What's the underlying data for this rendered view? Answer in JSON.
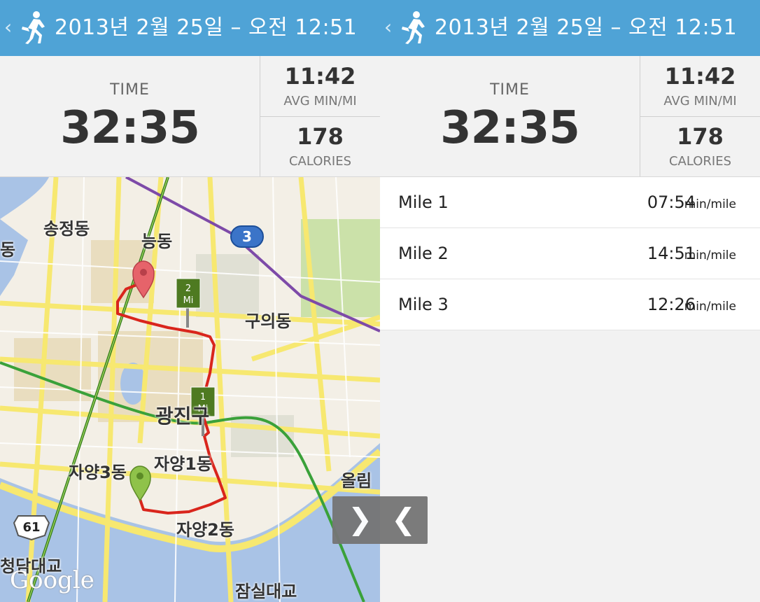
{
  "header": {
    "back_glyph": "‹",
    "runner_icon": "runner-icon",
    "title": "2013년 2월 25일 – 오전 12:51"
  },
  "stats": {
    "time_label": "TIME",
    "time_value": "32:35",
    "pace_value": "11:42",
    "pace_label": "AVG MIN/MI",
    "calories_value": "178",
    "calories_label": "CALORIES"
  },
  "map": {
    "labels": {
      "songjeong": "송정동",
      "neung": "능동",
      "dong_left": "동",
      "guui": "구의동",
      "gwangjin": "광진구",
      "jayang3": "자양3동",
      "jayang1": "자양1동",
      "jayang2": "자양2동",
      "ollim": "올림",
      "damdae": "청담대교",
      "jamsil": "잠실대교",
      "subway_line": "3",
      "highway": "61",
      "marker_2": "2",
      "marker_1": "1",
      "marker_unit": "Mi"
    },
    "attribution": "Google",
    "colors": {
      "route": "#d9251c",
      "water": "#a9c3e6",
      "road": "#f7e870",
      "park": "#cbe1a9",
      "start_pin": "#8fc24a",
      "end_pin": "#e6636a",
      "mile_marker": "#4e7a21"
    }
  },
  "splits": [
    {
      "mile": "Mile 1",
      "pace": "07:54",
      "unit": "min/mile"
    },
    {
      "mile": "Mile 2",
      "pace": "14:51",
      "unit": "min/mile"
    },
    {
      "mile": "Mile 3",
      "pace": "12:26",
      "unit": "min/mile"
    }
  ],
  "toggle": {
    "expand_glyph": "❯",
    "collapse_glyph": "❮"
  }
}
